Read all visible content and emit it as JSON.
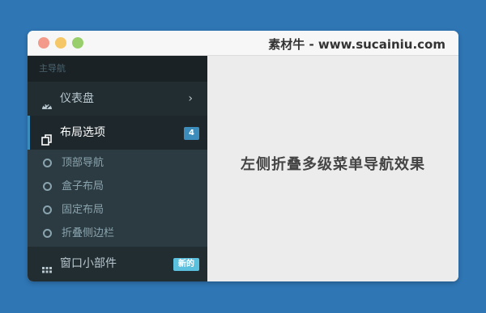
{
  "window": {
    "title": "素材牛 - www.sucainiu.com"
  },
  "sidebar": {
    "header": "主导航",
    "items": [
      {
        "label": "仪表盘",
        "icon": "dashboard-icon",
        "chevron": "›"
      },
      {
        "label": "布局选项",
        "icon": "copy-icon",
        "badge": "4",
        "badge_color": "#3c8dbc"
      },
      {
        "label": "窗口小部件",
        "icon": "grid-icon",
        "badge": "新的",
        "badge_color": "#5bc0de"
      }
    ],
    "submenu": [
      {
        "label": "顶部导航"
      },
      {
        "label": "盒子布局"
      },
      {
        "label": "固定布局"
      },
      {
        "label": "折叠侧边栏"
      }
    ]
  },
  "main": {
    "text": "左侧折叠多级菜单导航效果"
  },
  "colors": {
    "background": "#2f76b5",
    "sidebar": "#222d32",
    "accent": "#3c8dbc"
  }
}
